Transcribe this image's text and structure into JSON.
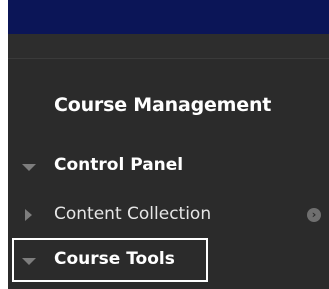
{
  "menu": {
    "section_title": "Course Management",
    "items": [
      {
        "label": "Control Panel",
        "state": "expanded",
        "icon": "triangle-down-icon"
      },
      {
        "label": "Content Collection",
        "state": "collapsed",
        "icon": "triangle-right-icon",
        "trailing_icon": "circle-arrow-right-icon"
      },
      {
        "label": "Course Tools",
        "state": "expanded",
        "icon": "triangle-down-icon",
        "focused": true
      }
    ]
  },
  "colors": {
    "top_bar": "#0b1557",
    "panel_bg": "#2b2b2b",
    "text": "#ffffff",
    "muted_icon": "#7d7d7d"
  }
}
